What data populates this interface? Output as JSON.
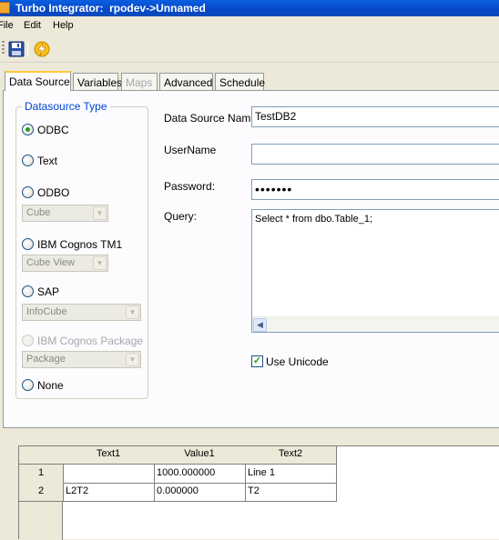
{
  "window": {
    "title": "Turbo Integrator:  rpodev->Unnamed"
  },
  "menu": [
    {
      "label": "File"
    },
    {
      "label": "Edit"
    },
    {
      "label": "Help"
    }
  ],
  "toolbar": {
    "icons": [
      "save-icon",
      "run-icon"
    ]
  },
  "tabs": [
    {
      "label": "Data Source",
      "active": true,
      "enabled": true
    },
    {
      "label": "Variables",
      "active": false,
      "enabled": true
    },
    {
      "label": "Maps",
      "active": false,
      "enabled": false
    },
    {
      "label": "Advanced",
      "active": false,
      "enabled": true
    },
    {
      "label": "Schedule",
      "active": false,
      "enabled": true
    }
  ],
  "datasource": {
    "group_title": "Datasource Type",
    "options": [
      {
        "label": "ODBC",
        "selected": true,
        "enabled": true
      },
      {
        "label": "Text",
        "selected": false,
        "enabled": true
      },
      {
        "label": "ODBO",
        "selected": false,
        "enabled": true
      },
      {
        "label": "IBM Cognos TM1",
        "selected": false,
        "enabled": true
      },
      {
        "label": "SAP",
        "selected": false,
        "enabled": true
      },
      {
        "label": "IBM Cognos Package",
        "selected": false,
        "enabled": false
      },
      {
        "label": "None",
        "selected": false,
        "enabled": true
      }
    ],
    "combos": [
      {
        "value": "Cube"
      },
      {
        "value": "Cube View"
      },
      {
        "value": "InfoCube"
      },
      {
        "value": "Package"
      }
    ]
  },
  "form": {
    "datasource_name_label": "Data Source Name:",
    "datasource_name_value": "TestDB2",
    "username_label": "UserName",
    "password_label": "Password:",
    "password_value": "•••••••",
    "query_label": "Query:",
    "query_value": "Select * from dbo.Table_1;",
    "use_unicode_label": "Use Unicode",
    "use_unicode_checked": true
  },
  "preview_grid": {
    "columns": [
      "Text1",
      "Value1",
      "Text2"
    ],
    "rows": [
      {
        "num": "1",
        "cells": [
          "",
          "1000.000000",
          "Line 1"
        ]
      },
      {
        "num": "2",
        "cells": [
          "L2T2",
          "0.000000",
          "T2"
        ]
      }
    ]
  },
  "colors": {
    "title_bar": "#0648c8",
    "window_bg": "#ece9d8",
    "group_title": "#0046d5",
    "tab_highlight": "#ffc83c",
    "radio_dot": "#21a121"
  }
}
